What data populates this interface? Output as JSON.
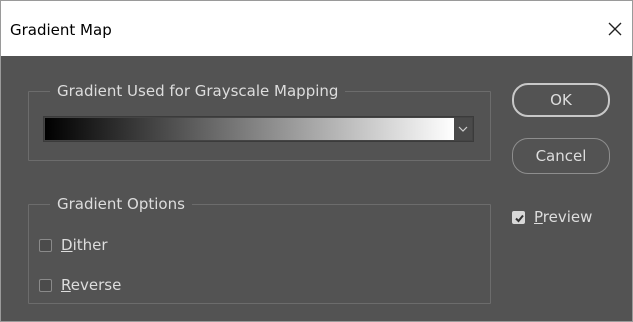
{
  "window": {
    "title": "Gradient Map",
    "close_icon": "close-icon"
  },
  "gradient_group": {
    "legend": "Gradient Used for Grayscale Mapping",
    "gradient": {
      "from_color": "#000000",
      "to_color": "#ffffff"
    },
    "dropdown_icon": "chevron-down-icon"
  },
  "options_group": {
    "legend": "Gradient Options",
    "dither": {
      "mnemonic": "D",
      "rest": "ither",
      "checked": false
    },
    "reverse": {
      "mnemonic": "R",
      "rest": "everse",
      "checked": false
    }
  },
  "buttons": {
    "ok_label": "OK",
    "cancel_label": "Cancel"
  },
  "preview": {
    "mnemonic": "P",
    "rest": "review",
    "checked": true
  },
  "colors": {
    "dialog_background": "#535353",
    "text": "#dddddd",
    "titlebar": "#ffffff"
  }
}
